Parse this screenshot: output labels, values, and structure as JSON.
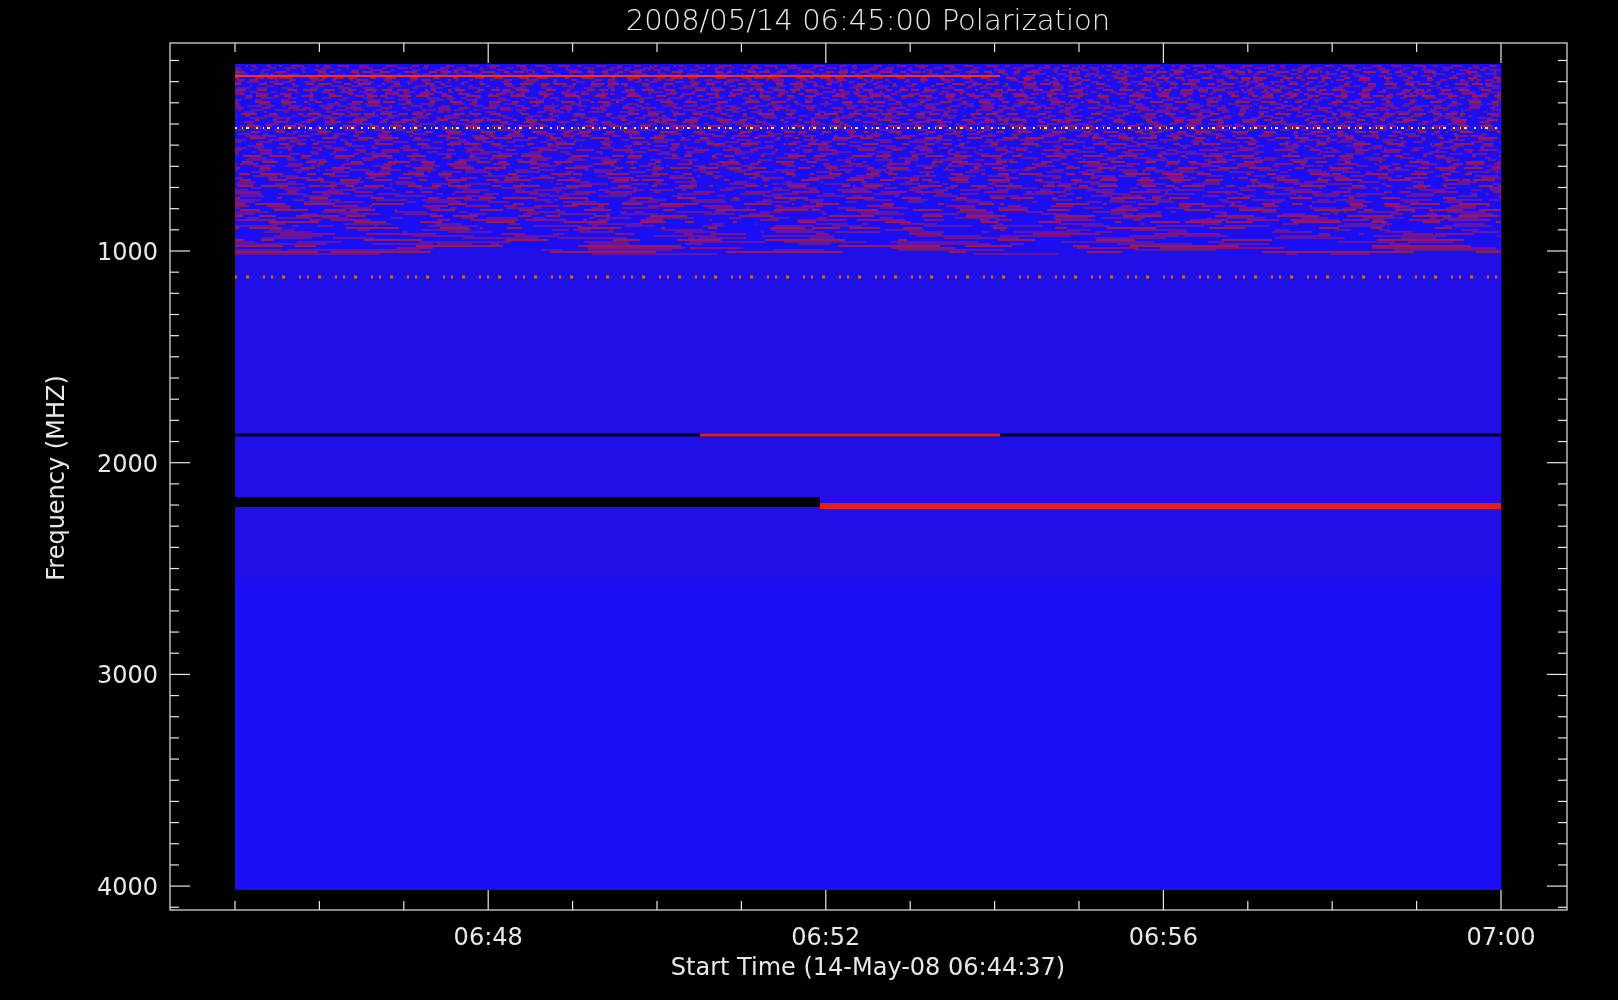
{
  "title": "2008/05/14 06:45:00 Polarization",
  "y_axis": {
    "label": "Frequency (MHZ)",
    "ticks": [
      "1000",
      "2000",
      "3000",
      "4000"
    ]
  },
  "x_axis": {
    "label": "Start Time (14-May-08 06:44:37)",
    "ticks": [
      "06:48",
      "06:52",
      "06:56",
      "07:00"
    ]
  }
}
